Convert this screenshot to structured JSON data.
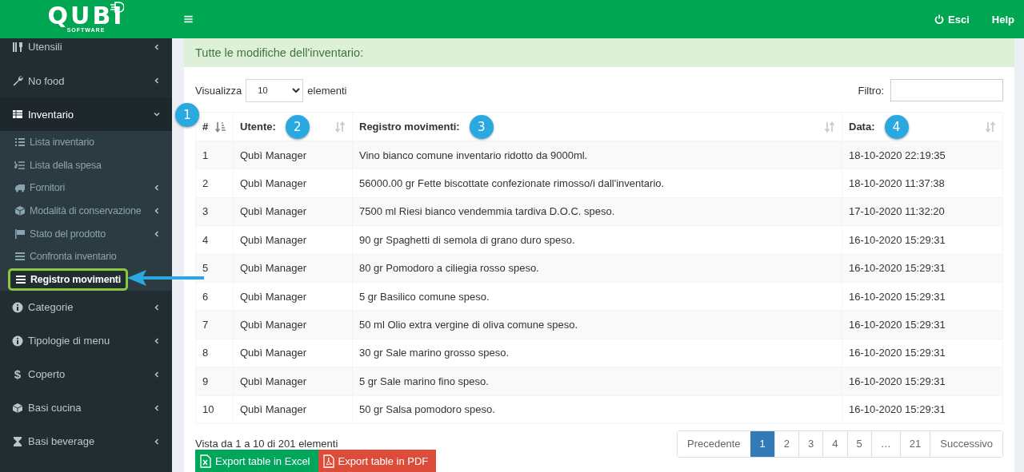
{
  "sidebar": {
    "logo": {
      "text": "QUBI",
      "subtext": "SOFTWARE"
    },
    "items": [
      {
        "label": "Utensili",
        "expanded": false,
        "selected": false
      },
      {
        "label": "No food",
        "expanded": false,
        "selected": false
      },
      {
        "label": "Inventario",
        "expanded": true,
        "selected": true,
        "children": [
          {
            "label": "Lista inventario",
            "selected": false
          },
          {
            "label": "Lista della spesa",
            "selected": false
          },
          {
            "label": "Fornitori",
            "selected": false,
            "expanded": false
          },
          {
            "label": "Modalità di conservazione",
            "selected": false,
            "expanded": false
          },
          {
            "label": "Stato del prodotto",
            "selected": false,
            "expanded": false
          },
          {
            "label": "Confronta inventario",
            "selected": false
          },
          {
            "label": "Registro movimenti",
            "selected": true
          }
        ]
      },
      {
        "label": "Categorie",
        "expanded": false,
        "selected": false
      },
      {
        "label": "Tipologie di menu",
        "expanded": false,
        "selected": false
      },
      {
        "label": "Coperto",
        "expanded": false,
        "selected": false,
        "icon_glyph": "$"
      },
      {
        "label": "Basi cucina",
        "expanded": false,
        "selected": false
      },
      {
        "label": "Basi beverage",
        "expanded": false,
        "selected": false
      }
    ]
  },
  "header": {
    "links": [
      {
        "label": "Esci",
        "kind": "power"
      },
      {
        "label": "Help",
        "kind": "plain"
      }
    ]
  },
  "box": {
    "title": "Tutte le modifiche dell'inventario:",
    "length_control": {
      "before": "Visualizza",
      "value": "10",
      "after": "elementi"
    },
    "filter": {
      "label": "Filtro:"
    },
    "table": {
      "columns": [
        {
          "label": "#",
          "sorted": true,
          "callout": "1"
        },
        {
          "label": "Utente:",
          "sorted": false,
          "callout": "2"
        },
        {
          "label": "Registro movimenti:",
          "sorted": false,
          "callout": "3"
        },
        {
          "label": "Data:",
          "sorted": false,
          "callout": "4"
        }
      ],
      "rows": [
        [
          "1",
          "Qubì Manager",
          "Vino bianco comune inventario ridotto da 9000ml.",
          "18-10-2020 22:19:35"
        ],
        [
          "2",
          "Qubì Manager",
          "56000.00 gr Fette biscottate confezionate rimosso/i dall'inventario.",
          "18-10-2020 11:37:38"
        ],
        [
          "3",
          "Qubì Manager",
          "7500 ml Riesi bianco vendemmia tardiva D.O.C. speso.",
          "17-10-2020 11:32:20"
        ],
        [
          "4",
          "Qubì Manager",
          "90 gr Spaghetti di semola di grano duro speso.",
          "16-10-2020 15:29:31"
        ],
        [
          "5",
          "Qubì Manager",
          "80 gr Pomodoro a ciliegia rosso speso.",
          "16-10-2020 15:29:31"
        ],
        [
          "6",
          "Qubì Manager",
          "5 gr Basilico comune speso.",
          "16-10-2020 15:29:31"
        ],
        [
          "7",
          "Qubì Manager",
          "50 ml Olio extra vergine di oliva comune speso.",
          "16-10-2020 15:29:31"
        ],
        [
          "8",
          "Qubì Manager",
          "30 gr Sale marino grosso speso.",
          "16-10-2020 15:29:31"
        ],
        [
          "9",
          "Qubì Manager",
          "5 gr Sale marino fino speso.",
          "16-10-2020 15:29:31"
        ],
        [
          "10",
          "Qubì Manager",
          "50 gr Salsa pomodoro speso.",
          "16-10-2020 15:29:31"
        ]
      ]
    },
    "info": "Vista da 1 a 10 di 201 elementi",
    "exports": [
      {
        "label": "Export table in Excel",
        "kind": "excel"
      },
      {
        "label": "Export table in PDF",
        "kind": "pdf"
      }
    ],
    "pagination": [
      {
        "label": "Precedente",
        "kind": "nav",
        "selected": false
      },
      {
        "label": "1",
        "kind": "page",
        "selected": true
      },
      {
        "label": "2",
        "kind": "page",
        "selected": false
      },
      {
        "label": "3",
        "kind": "page",
        "selected": false
      },
      {
        "label": "4",
        "kind": "page",
        "selected": false
      },
      {
        "label": "5",
        "kind": "page",
        "selected": false
      },
      {
        "label": "…",
        "kind": "gap",
        "selected": false
      },
      {
        "label": "21",
        "kind": "page",
        "selected": false
      },
      {
        "label": "Successivo",
        "kind": "nav",
        "selected": false
      }
    ]
  }
}
